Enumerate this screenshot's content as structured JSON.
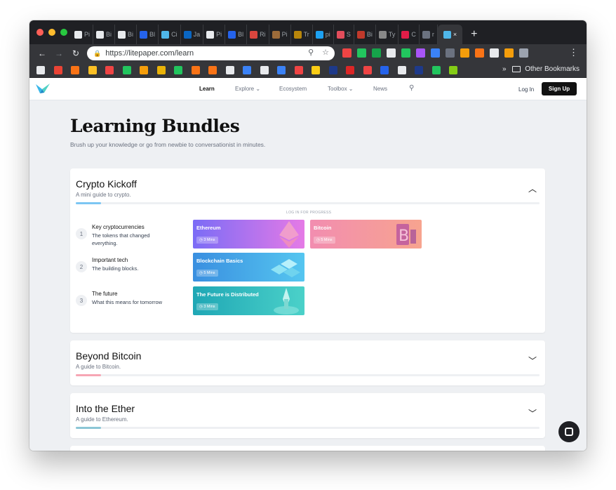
{
  "browser": {
    "traffic_lights": [
      "#ff5f57",
      "#febc2e",
      "#28c840"
    ],
    "tabs": [
      {
        "label": "Pi",
        "color": "#e8eaed"
      },
      {
        "label": "Bi",
        "color": "#e8eaed"
      },
      {
        "label": "Bi",
        "color": "#e8eaed"
      },
      {
        "label": "Bl",
        "color": "#2563eb"
      },
      {
        "label": "Ci",
        "color": "#4fb7ea"
      },
      {
        "label": "Ja",
        "color": "#0a66c2"
      },
      {
        "label": "Pi",
        "color": "#e8eaed"
      },
      {
        "label": "Bl",
        "color": "#2563eb"
      },
      {
        "label": "Ri",
        "color": "#d9463e"
      },
      {
        "label": "Pi",
        "color": "#9c6b3a"
      },
      {
        "label": "Tr",
        "color": "#b8860b"
      },
      {
        "label": "pi",
        "color": "#1da1f2"
      },
      {
        "label": "S",
        "color": "#e24d5b"
      },
      {
        "label": "Bi",
        "color": "#c0392b"
      },
      {
        "label": "Ty",
        "color": "#888888"
      },
      {
        "label": "C",
        "color": "#e11d48"
      },
      {
        "label": "r",
        "color": "#6b7280"
      }
    ],
    "active_tab_close": "×",
    "new_tab": "+",
    "url": "https://litepaper.com/learn",
    "other_bookmarks": "Other Bookmarks",
    "bookmarks_overflow": "»",
    "bookmark_colors": [
      "#e8eaed",
      "#ea4335",
      "#f97316",
      "#fbbf24",
      "#ef4444",
      "#22c55e",
      "#f59e0b",
      "#eab308",
      "#22c55e",
      "#f97316",
      "#f97316",
      "#e8eaed",
      "#3b82f6",
      "#e8eaed",
      "#3b82f6",
      "#ef4444",
      "#facc15",
      "#1e3a8a",
      "#dc2626",
      "#ef4444",
      "#2563eb",
      "#e8eaed",
      "#1e3a8a",
      "#22c55e",
      "#84cc16"
    ]
  },
  "site": {
    "nav": {
      "learn": "Learn",
      "explore": "Explore ⌄",
      "ecosystem": "Ecosystem",
      "toolbox": "Toolbox ⌄",
      "news": "News",
      "login": "Log In",
      "signup": "Sign Up"
    },
    "page_title": "Learning Bundles",
    "page_subtitle": "Brush up your knowledge or go from newbie to conversationist in minutes.",
    "bundles": [
      {
        "title": "Crypto Kickoff",
        "desc": "A mini guide to crypto.",
        "progress_color": "#7cc6f3",
        "progress": 0.054,
        "expanded": true,
        "login_note": "LOG IN FOR PROGRESS",
        "steps": [
          {
            "num": "1",
            "title": "Key cryptocurrencies",
            "desc": "The tokens that changed everything."
          },
          {
            "num": "2",
            "title": "Important tech",
            "desc": "The building blocks."
          },
          {
            "num": "3",
            "title": "The future",
            "desc": "What this means for tomorrow"
          }
        ],
        "lessons": [
          {
            "name": "Ethereum",
            "mins": "3 Mins",
            "c1": "#7b6cf6",
            "c2": "#e57ae6"
          },
          {
            "name": "Bitcoin",
            "mins": "5 Mins",
            "c1": "#f28db0",
            "c2": "#f7a48f"
          },
          {
            "name": "Blockchain Basics",
            "mins": "5 Mins",
            "c1": "#3a8fe0",
            "c2": "#55c6f0"
          },
          {
            "name": "The Future is Distributed",
            "mins": "3 Mins",
            "c1": "#1fa7b5",
            "c2": "#4bd1c9"
          }
        ]
      },
      {
        "title": "Beyond Bitcoin",
        "desc": "A guide to Bitcoin.",
        "progress_color": "#f7a6b4",
        "progress": 0.054
      },
      {
        "title": "Into the Ether",
        "desc": "A guide to Ethereum.",
        "progress_color": "#8cc6d6",
        "progress": 0.054
      }
    ]
  }
}
